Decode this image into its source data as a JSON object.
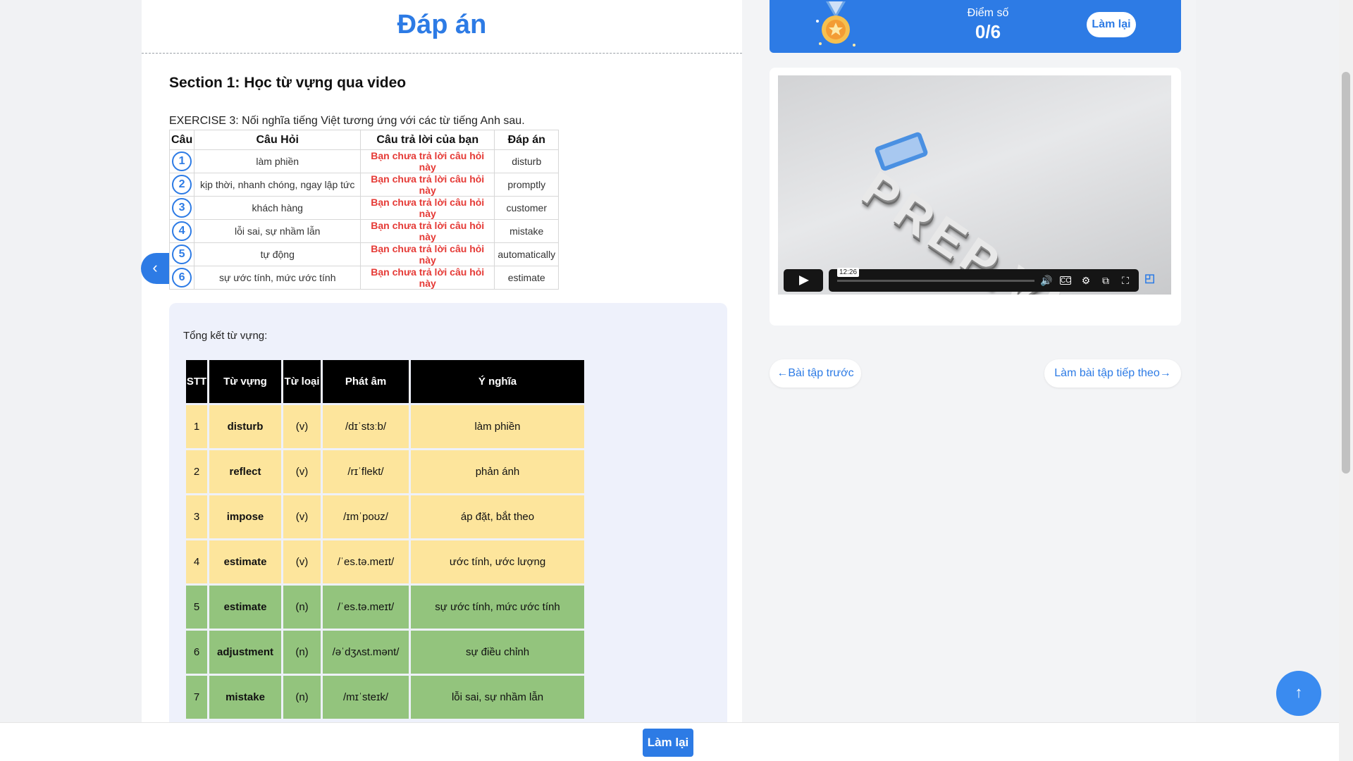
{
  "answer_panel": {
    "title": "Đáp án",
    "section_title": "Section 1: Học từ vựng qua video",
    "exercise_text": "EXERCISE 3: Nối nghĩa tiếng Việt tương ứng với các từ tiếng Anh sau.",
    "table_headers": [
      "Câu",
      "Câu Hỏi",
      "Câu trả lời của bạn",
      "Đáp án"
    ],
    "rows": [
      {
        "num": "1",
        "question": "làm phiền",
        "your_answer": "Bạn chưa trả lời câu hỏi này",
        "answer": "disturb"
      },
      {
        "num": "2",
        "question": "kịp thời, nhanh chóng, ngay lập tức",
        "your_answer": "Bạn chưa trả lời câu hỏi này",
        "answer": "promptly"
      },
      {
        "num": "3",
        "question": "khách hàng",
        "your_answer": "Bạn chưa trả lời câu hỏi này",
        "answer": "customer"
      },
      {
        "num": "4",
        "question": "lỗi sai, sự nhầm lẫn",
        "your_answer": "Bạn chưa trả lời câu hỏi này",
        "answer": "mistake"
      },
      {
        "num": "5",
        "question": "tự động",
        "your_answer": "Bạn chưa trả lời câu hỏi này",
        "answer": "automatically"
      },
      {
        "num": "6",
        "question": "sự ước tính, mức ước tính",
        "your_answer": "Bạn chưa trả lời câu hỏi này",
        "answer": "estimate"
      }
    ]
  },
  "summary": {
    "title": "Tổng kết từ vựng:",
    "headers": [
      "STT",
      "Từ vựng",
      "Từ loại",
      "Phát âm",
      "Ý nghĩa"
    ],
    "rows": [
      {
        "stt": "1",
        "word": "disturb",
        "pos": "(v)",
        "ipa": "/dɪˈstɜːb/",
        "meaning": "làm phiền"
      },
      {
        "stt": "2",
        "word": "reflect",
        "pos": "(v)",
        "ipa": "/rɪˈflekt/",
        "meaning": "phản ánh"
      },
      {
        "stt": "3",
        "word": "impose",
        "pos": "(v)",
        "ipa": "/ɪmˈpoʊz/",
        "meaning": "áp đặt, bắt theo"
      },
      {
        "stt": "4",
        "word": "estimate",
        "pos": "(v)",
        "ipa": "/ˈes.tə.meɪt/",
        "meaning": "ước tính, ước lượng"
      },
      {
        "stt": "5",
        "word": "estimate",
        "pos": "(n)",
        "ipa": "/ˈes.tə.meɪt/",
        "meaning": "sự ước tính, mức ước tính"
      },
      {
        "stt": "6",
        "word": "adjustment",
        "pos": "(n)",
        "ipa": "/əˈdʒʌst.mənt/",
        "meaning": "sự điều chỉnh"
      },
      {
        "stt": "7",
        "word": "mistake",
        "pos": "(n)",
        "ipa": "/mɪˈsteɪk/",
        "meaning": "lỗi sai, sự nhầm lẫn"
      }
    ]
  },
  "score_card": {
    "label": "Điểm số",
    "value": "0/6",
    "redo_label": "Làm lại"
  },
  "video": {
    "logo_text": "PREP.VN",
    "timestamp": "12:26"
  },
  "navigation": {
    "prev_label": "←Bài tập trước",
    "next_label": "Làm bài tập tiếp theo→"
  },
  "bottom_bar": {
    "redo_label": "Làm lại"
  },
  "icons": {
    "collapse": "chevron-left-icon",
    "scroll_top": "arrow-up-icon",
    "medal": "medal-icon"
  },
  "colors": {
    "brand_blue": "#2d7be5",
    "error_red": "#e53935",
    "row_yellow": "#fde59c",
    "row_green": "#93c47d"
  }
}
